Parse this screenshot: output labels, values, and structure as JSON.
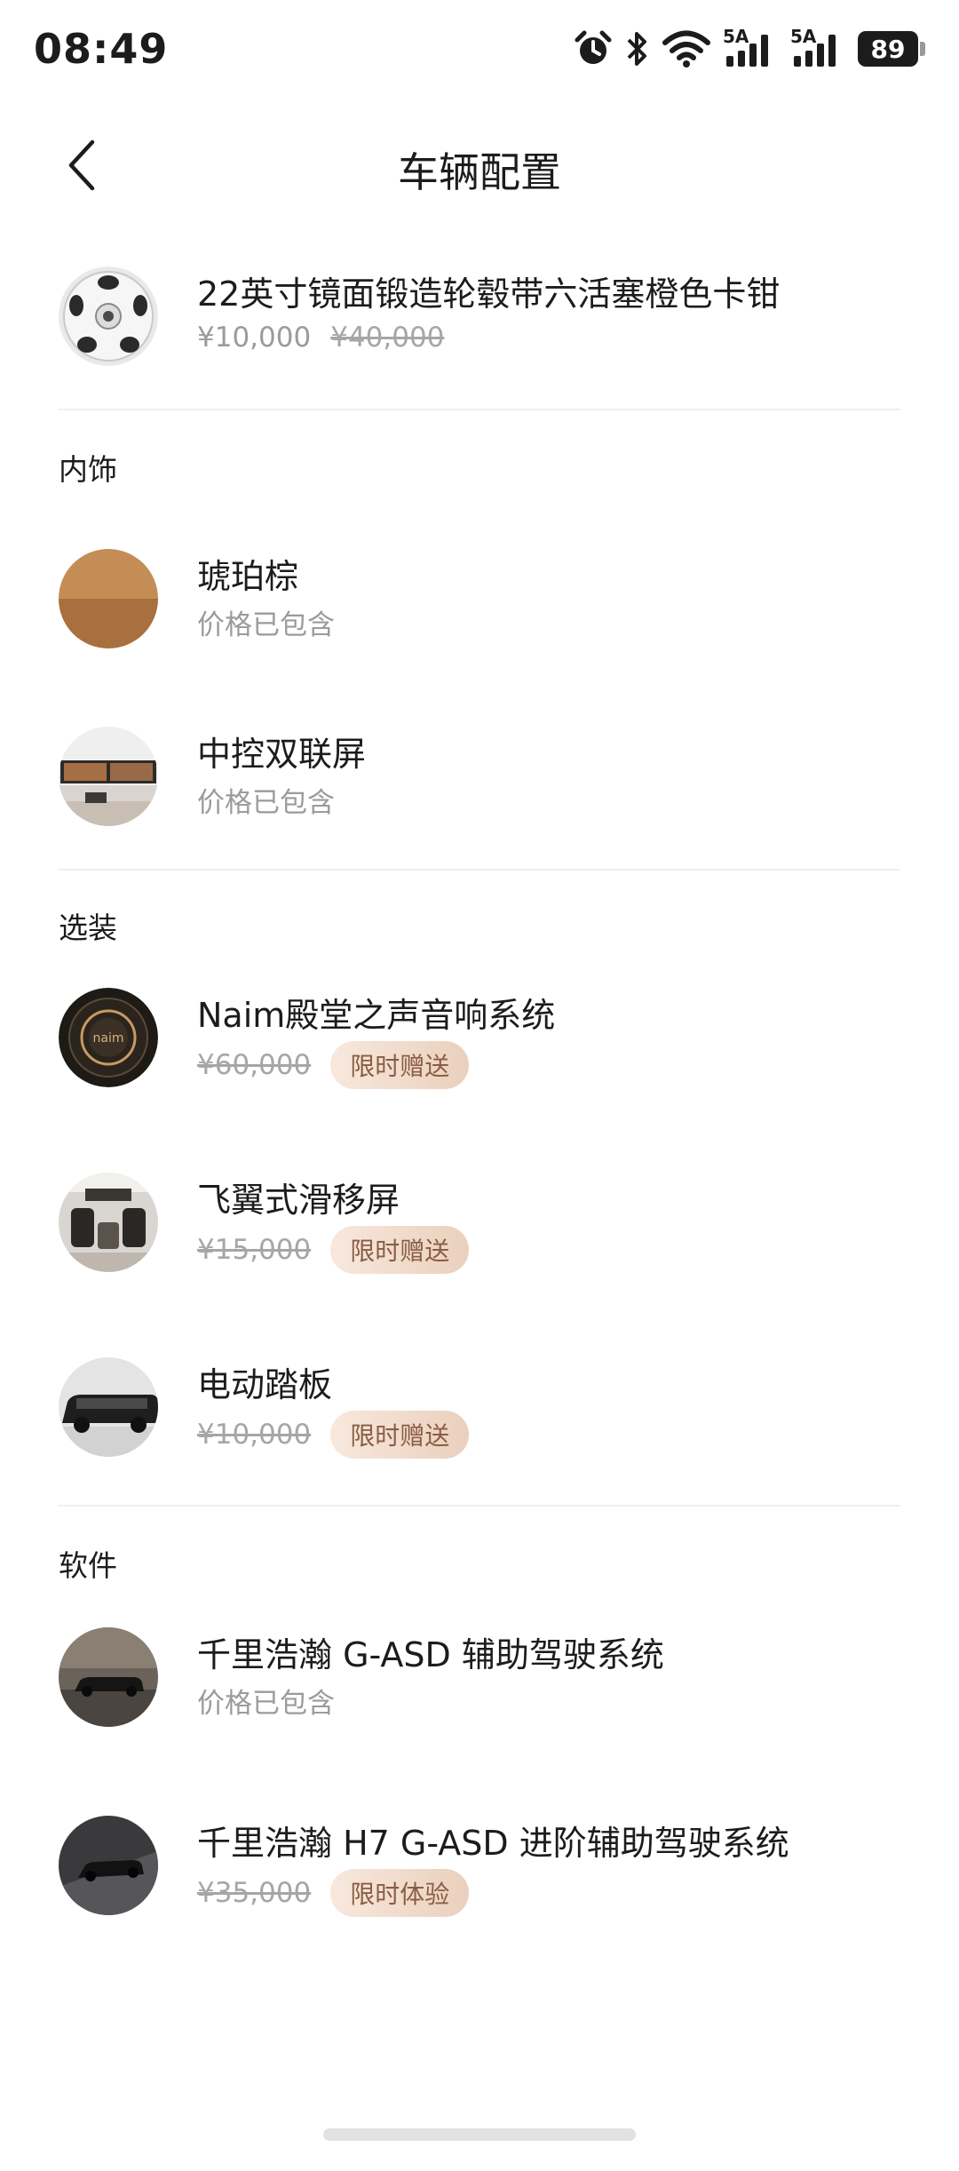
{
  "status_bar": {
    "time": "08:49",
    "battery": "89",
    "signal_label_1": "5A",
    "signal_label_2": "5A",
    "icons": [
      "alarm-icon",
      "bluetooth-icon",
      "wifi-icon",
      "signal-icon",
      "signal-icon",
      "battery-icon"
    ]
  },
  "header": {
    "title": "车辆配置",
    "back_icon": "chevron-left-icon"
  },
  "wheels": {
    "name": "22英寸镜面锻造轮毂带六活塞橙色卡钳",
    "price": "¥10,000",
    "original_price": "¥40,000"
  },
  "sections": {
    "interior": {
      "title": "内饰",
      "items": [
        {
          "name": "琥珀棕",
          "status": "价格已包含"
        },
        {
          "name": "中控双联屏",
          "status": "价格已包含"
        }
      ]
    },
    "options": {
      "title": "选装",
      "items": [
        {
          "name": "Naim殿堂之声音响系统",
          "original_price": "¥60,000",
          "badge": "限时赠送"
        },
        {
          "name": "飞翼式滑移屏",
          "original_price": "¥15,000",
          "badge": "限时赠送"
        },
        {
          "name": "电动踏板",
          "original_price": "¥10,000",
          "badge": "限时赠送"
        }
      ]
    },
    "software": {
      "title": "软件",
      "items": [
        {
          "name": "千里浩瀚 G-ASD 辅助驾驶系统",
          "status": "价格已包含"
        },
        {
          "name": "千里浩瀚 H7 G-ASD 进阶辅助驾驶系统",
          "original_price": "¥35,000",
          "badge": "限时体验"
        }
      ]
    }
  },
  "colors": {
    "badge_text": "#8a5d45",
    "badge_bg_start": "#f8e8dd",
    "badge_bg_end": "#ead0bd",
    "secondary_text": "#9b9b9b"
  }
}
